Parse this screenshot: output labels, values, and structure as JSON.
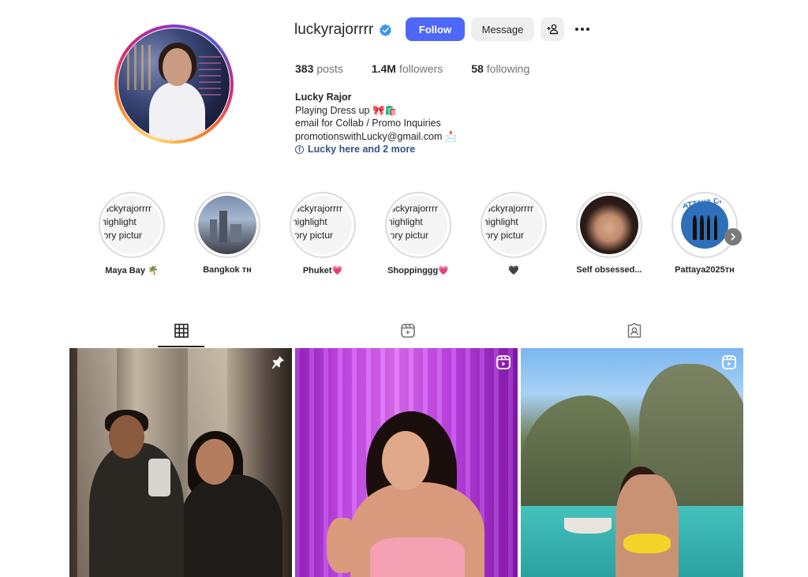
{
  "profile": {
    "username": "luckyrajorrrr",
    "follow_label": "Follow",
    "message_label": "Message"
  },
  "stats": {
    "posts_count": "383",
    "posts_label": "posts",
    "followers_count": "1.4M",
    "followers_label": "followers",
    "following_count": "58",
    "following_label": "following"
  },
  "bio": {
    "name": "Lucky Rajor",
    "line1": "Playing Dress up 🎀🛍️",
    "line2": "email for Collab / Promo Inquiries",
    "line3": "promotionswithLucky@gmail.com 📩",
    "link": "Lucky here and 2 more"
  },
  "highlights": [
    {
      "label": "Maya Bay 🌴",
      "placeholder": [
        "ıuckyrajorrrr",
        "highlight",
        "ʼory pictur"
      ]
    },
    {
      "label": "Bangkok ᴛʜ"
    },
    {
      "label": "Phuket💗",
      "placeholder": [
        "ıuckyrajorrrr",
        "highlight",
        "ʼory pictur"
      ]
    },
    {
      "label": "Shoppinggg💗",
      "placeholder": [
        "ıuckyrajorrrr",
        "highlight",
        "ʼory pictur"
      ]
    },
    {
      "label": "🖤",
      "placeholder": [
        "ıuckyrajorrrr",
        "highlight",
        "ʼory pictur"
      ]
    },
    {
      "label": "Self obsessed..."
    },
    {
      "label": "Pattaya2025ᴛʜ",
      "logo_text": "PATTAYA CITY"
    }
  ],
  "icons": {
    "verified": "verified-badge-icon",
    "suggest": "add-person-icon",
    "more": "more-options-icon",
    "grid_tab": "grid-icon",
    "reels_tab": "reels-icon",
    "tagged_tab": "tagged-icon",
    "pin": "pin-icon",
    "reel": "reel-icon",
    "next": "chevron-right-icon",
    "facebook": "facebook-icon"
  },
  "colors": {
    "accent": "#4f67f6",
    "verified": "#3797f0",
    "link": "#385185"
  }
}
